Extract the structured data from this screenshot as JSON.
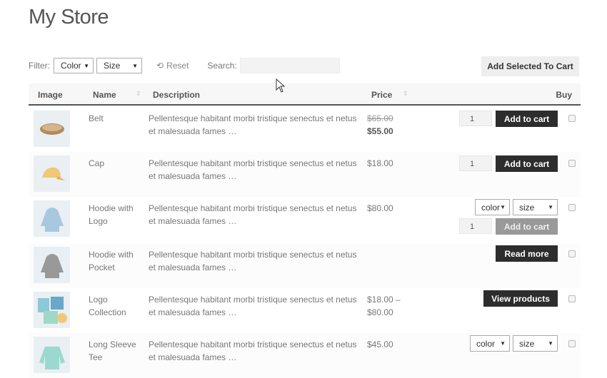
{
  "title": "My Store",
  "filter": {
    "label": "Filter:",
    "color": "Color",
    "size": "Size",
    "reset": "Reset",
    "search_label": "Search:",
    "search_value": ""
  },
  "add_selected": "Add Selected To Cart",
  "columns": {
    "image": "Image",
    "name": "Name",
    "description": "Description",
    "price": "Price",
    "buy": "Buy"
  },
  "rows": [
    {
      "name": "Belt",
      "desc": "Pellentesque habitant morbi tristique senectus et netus et malesuada fames …",
      "old_price": "$65.00",
      "price": "$55.00",
      "qty": "1",
      "button": "Add to cart"
    },
    {
      "name": "Cap",
      "desc": "Pellentesque habitant morbi tristique senectus et netus et malesuada fames …",
      "price": "$18.00",
      "qty": "1",
      "button": "Add to cart"
    },
    {
      "name": "Hoodie with Logo",
      "desc": "Pellentesque habitant morbi tristique senectus et netus et malesuada fames …",
      "price": "$80.00",
      "color": "color",
      "size": "size",
      "qty": "1",
      "button": "Add to cart"
    },
    {
      "name": "Hoodie with Pocket",
      "desc": "Pellentesque habitant morbi tristique senectus et netus et malesuada fames …",
      "button": "Read more"
    },
    {
      "name": "Logo Collection",
      "desc": "Pellentesque habitant morbi tristique senectus et netus et malesuada fames …",
      "price": "$18.00 – $80.00",
      "button": "View products"
    },
    {
      "name": "Long Sleeve Tee",
      "desc": "Pellentesque habitant morbi tristique senectus et netus et malesuada fames …",
      "price": "$45.00",
      "color": "color",
      "size": "size"
    }
  ]
}
